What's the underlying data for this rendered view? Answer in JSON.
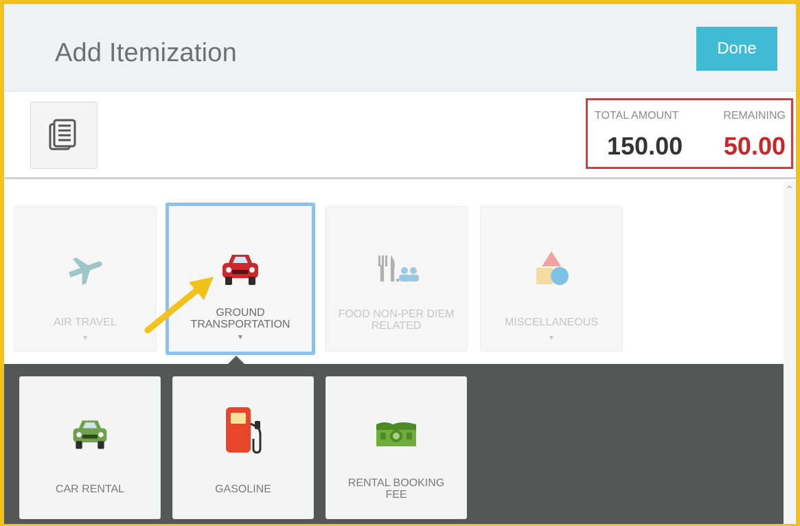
{
  "header": {
    "title": "Add Itemization",
    "done_label": "Done"
  },
  "toolbar": {
    "doc_icon": "document-list-icon"
  },
  "totals": {
    "total_label": "TOTAL AMOUNT",
    "total_value": "150.00",
    "remaining_label": "REMAINING",
    "remaining_value": "50.00",
    "remaining_color": "#c8272a",
    "highlight_color": "#d63b3b"
  },
  "categories": [
    {
      "label": "AIR TRAVEL",
      "icon": "airplane-icon",
      "selected": false
    },
    {
      "label": "GROUND\nTRANSPORTATION",
      "icon": "car-icon",
      "selected": true
    },
    {
      "label": "FOOD NON-PER DIEM\nRELATED",
      "icon": "food-people-icon",
      "selected": false
    },
    {
      "label": "MISCELLANEOUS",
      "icon": "shapes-icon",
      "selected": false
    }
  ],
  "subcategories": [
    {
      "label": "CAR RENTAL",
      "icon": "rental-car-icon"
    },
    {
      "label": "GASOLINE",
      "icon": "gas-pump-icon"
    },
    {
      "label": "RENTAL BOOKING\nFEE",
      "icon": "money-icon"
    }
  ],
  "colors": {
    "accent": "#3fbcd3",
    "selected_border": "#8cc1ec",
    "frame": "#f2c21b",
    "panel": "#555756",
    "arrow": "#f2c21b"
  }
}
